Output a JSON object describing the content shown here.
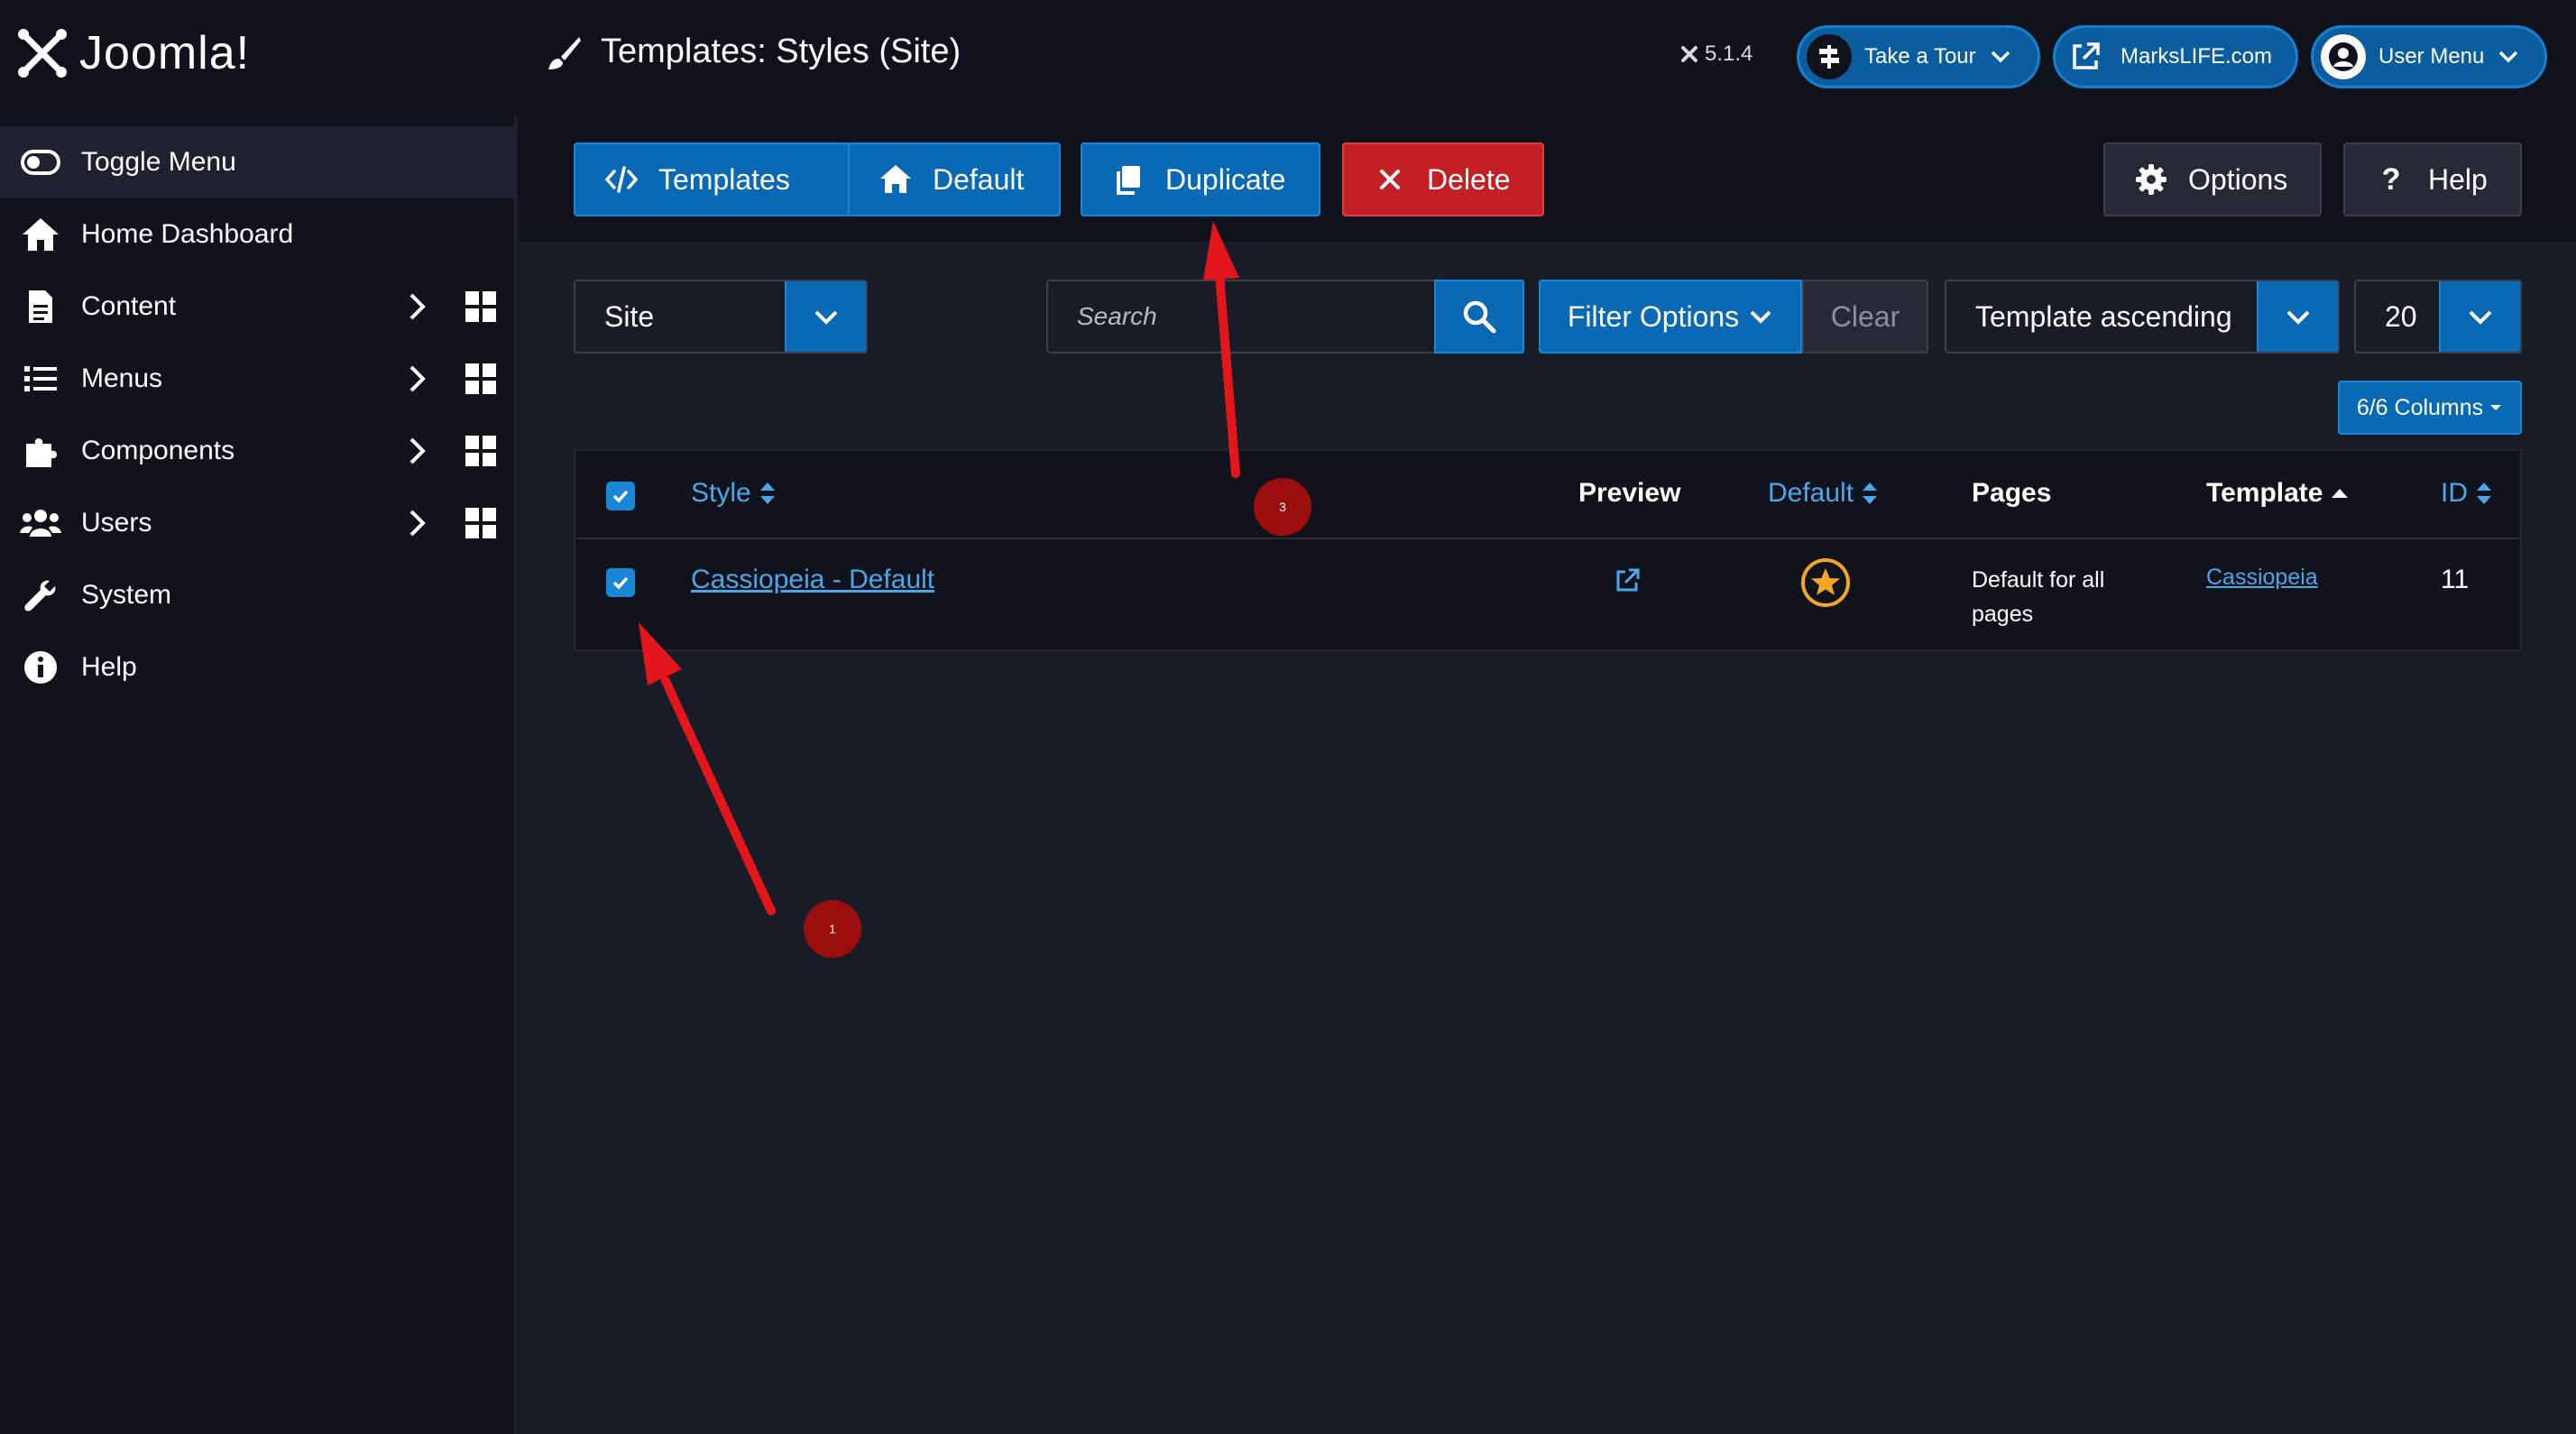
{
  "header": {
    "logo_text": "Joomla!",
    "page_title": "Templates: Styles (Site)",
    "version": "5.1.4",
    "take_tour": "Take a Tour",
    "site_link": "MarksLIFE.com",
    "user_menu": "User Menu"
  },
  "sidebar": {
    "items": [
      {
        "label": "Toggle Menu",
        "icon": "toggle-icon"
      },
      {
        "label": "Home Dashboard",
        "icon": "home-icon"
      },
      {
        "label": "Content",
        "icon": "file-icon"
      },
      {
        "label": "Menus",
        "icon": "list-icon"
      },
      {
        "label": "Components",
        "icon": "puzzle-icon"
      },
      {
        "label": "Users",
        "icon": "users-icon"
      },
      {
        "label": "System",
        "icon": "wrench-icon"
      },
      {
        "label": "Help",
        "icon": "info-icon"
      }
    ]
  },
  "toolbar": {
    "templates": "Templates",
    "default": "Default",
    "duplicate": "Duplicate",
    "delete": "Delete",
    "options": "Options",
    "help": "Help"
  },
  "filters": {
    "client": "Site",
    "search_placeholder": "Search",
    "filter_options": "Filter Options",
    "clear": "Clear",
    "ordering": "Template ascending",
    "limit": "20",
    "columns": "6/6 Columns"
  },
  "table": {
    "headers": {
      "style": "Style",
      "preview": "Preview",
      "default": "Default",
      "pages": "Pages",
      "template": "Template",
      "id": "ID"
    },
    "rows": [
      {
        "style": "Cassiopeia - Default",
        "pages": "Default for all pages",
        "pages_line1": "Default for all",
        "pages_line2": "pages",
        "template": "Cassiopeia",
        "id": "11",
        "checked": true
      }
    ]
  },
  "annotations": {
    "marker_1": "1",
    "marker_3": "3",
    "color": "#e3161b"
  },
  "colors": {
    "accent_blue": "#0a69b4",
    "danger_red": "#c31f24",
    "link_blue": "#4aa8ea",
    "star_orange": "#f5a623"
  }
}
